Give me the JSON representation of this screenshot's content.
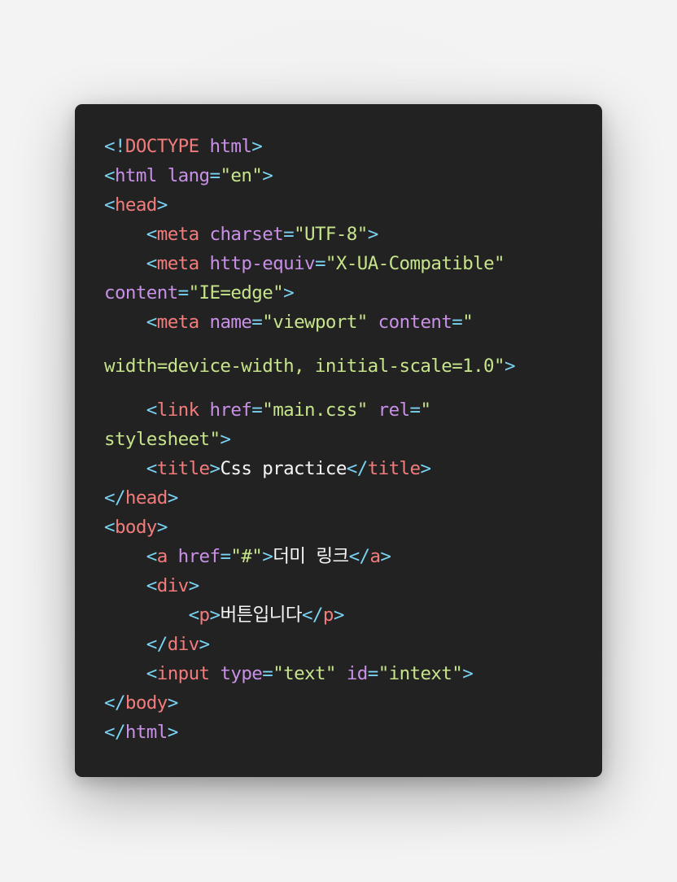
{
  "colors": {
    "background": "#f0f0f0",
    "editor_bg": "#222222",
    "punctuation": "#7ad3f2",
    "tag": "#f27c7c",
    "attribute": "#c890e6",
    "string": "#c6e48a",
    "text": "#f5f5f5"
  },
  "code": {
    "lines": [
      [
        [
          "p",
          "<!"
        ],
        [
          "t",
          "DOCTYPE"
        ],
        [
          "x",
          " "
        ],
        [
          "a",
          "html"
        ],
        [
          "p",
          ">"
        ]
      ],
      [
        [
          "p",
          "<"
        ],
        [
          "a",
          "html"
        ],
        [
          "x",
          " "
        ],
        [
          "a",
          "lang"
        ],
        [
          "p",
          "="
        ],
        [
          "s",
          "\"en\""
        ],
        [
          "p",
          ">"
        ]
      ],
      [
        [
          "p",
          "<"
        ],
        [
          "t",
          "head"
        ],
        [
          "p",
          ">"
        ]
      ],
      [
        [
          "x",
          "    "
        ],
        [
          "p",
          "<"
        ],
        [
          "t",
          "meta"
        ],
        [
          "x",
          " "
        ],
        [
          "a",
          "charset"
        ],
        [
          "p",
          "="
        ],
        [
          "s",
          "\"UTF-8\""
        ],
        [
          "p",
          ">"
        ]
      ],
      [
        [
          "x",
          "    "
        ],
        [
          "p",
          "<"
        ],
        [
          "t",
          "meta"
        ],
        [
          "x",
          " "
        ],
        [
          "a",
          "http-equiv"
        ],
        [
          "p",
          "="
        ],
        [
          "s",
          "\"X-UA-Compatible\""
        ]
      ],
      [
        [
          "a",
          "content"
        ],
        [
          "p",
          "="
        ],
        [
          "s",
          "\"IE=edge\""
        ],
        [
          "p",
          ">"
        ]
      ],
      [
        [
          "x",
          "    "
        ],
        [
          "p",
          "<"
        ],
        [
          "t",
          "meta"
        ],
        [
          "x",
          " "
        ],
        [
          "a",
          "name"
        ],
        [
          "p",
          "="
        ],
        [
          "s",
          "\"viewport\""
        ],
        [
          "x",
          " "
        ],
        [
          "a",
          "content"
        ],
        [
          "p",
          "="
        ],
        [
          "s",
          "\""
        ]
      ],
      [
        [
          "s",
          "width=device-width, initial-scale=1.0\""
        ],
        [
          "p",
          ">"
        ]
      ],
      [
        [
          "x",
          "    "
        ],
        [
          "p",
          "<"
        ],
        [
          "t",
          "link"
        ],
        [
          "x",
          " "
        ],
        [
          "a",
          "href"
        ],
        [
          "p",
          "="
        ],
        [
          "s",
          "\"main.css\""
        ],
        [
          "x",
          " "
        ],
        [
          "a",
          "rel"
        ],
        [
          "p",
          "="
        ],
        [
          "s",
          "\""
        ]
      ],
      [
        [
          "s",
          "stylesheet\""
        ],
        [
          "p",
          ">"
        ]
      ],
      [
        [
          "x",
          "    "
        ],
        [
          "p",
          "<"
        ],
        [
          "t",
          "title"
        ],
        [
          "p",
          ">"
        ],
        [
          "x",
          "Css practice"
        ],
        [
          "p",
          "</"
        ],
        [
          "t",
          "title"
        ],
        [
          "p",
          ">"
        ]
      ],
      [
        [
          "p",
          "</"
        ],
        [
          "t",
          "head"
        ],
        [
          "p",
          ">"
        ]
      ],
      [
        [
          "p",
          "<"
        ],
        [
          "t",
          "body"
        ],
        [
          "p",
          ">"
        ]
      ],
      [
        [
          "x",
          "    "
        ],
        [
          "p",
          "<"
        ],
        [
          "t",
          "a"
        ],
        [
          "x",
          " "
        ],
        [
          "a",
          "href"
        ],
        [
          "p",
          "="
        ],
        [
          "s",
          "\"#\""
        ],
        [
          "p",
          ">"
        ],
        [
          "x",
          "더미 링크"
        ],
        [
          "p",
          "</"
        ],
        [
          "t",
          "a"
        ],
        [
          "p",
          ">"
        ]
      ],
      [
        [
          "x",
          "    "
        ],
        [
          "p",
          "<"
        ],
        [
          "t",
          "div"
        ],
        [
          "p",
          ">"
        ]
      ],
      [
        [
          "x",
          "        "
        ],
        [
          "p",
          "<"
        ],
        [
          "t",
          "p"
        ],
        [
          "p",
          ">"
        ],
        [
          "x",
          "버튼입니다"
        ],
        [
          "p",
          "</"
        ],
        [
          "t",
          "p"
        ],
        [
          "p",
          ">"
        ]
      ],
      [
        [
          "x",
          "    "
        ],
        [
          "p",
          "</"
        ],
        [
          "t",
          "div"
        ],
        [
          "p",
          ">"
        ]
      ],
      [
        [
          "x",
          "    "
        ],
        [
          "p",
          "<"
        ],
        [
          "t",
          "input"
        ],
        [
          "x",
          " "
        ],
        [
          "a",
          "type"
        ],
        [
          "p",
          "="
        ],
        [
          "s",
          "\"text\""
        ],
        [
          "x",
          " "
        ],
        [
          "a",
          "id"
        ],
        [
          "p",
          "="
        ],
        [
          "s",
          "\"intext\""
        ],
        [
          "p",
          ">"
        ]
      ],
      [
        [
          "p",
          "</"
        ],
        [
          "t",
          "body"
        ],
        [
          "p",
          ">"
        ]
      ],
      [
        [
          "p",
          "</"
        ],
        [
          "a",
          "html"
        ],
        [
          "p",
          ">"
        ]
      ]
    ]
  }
}
